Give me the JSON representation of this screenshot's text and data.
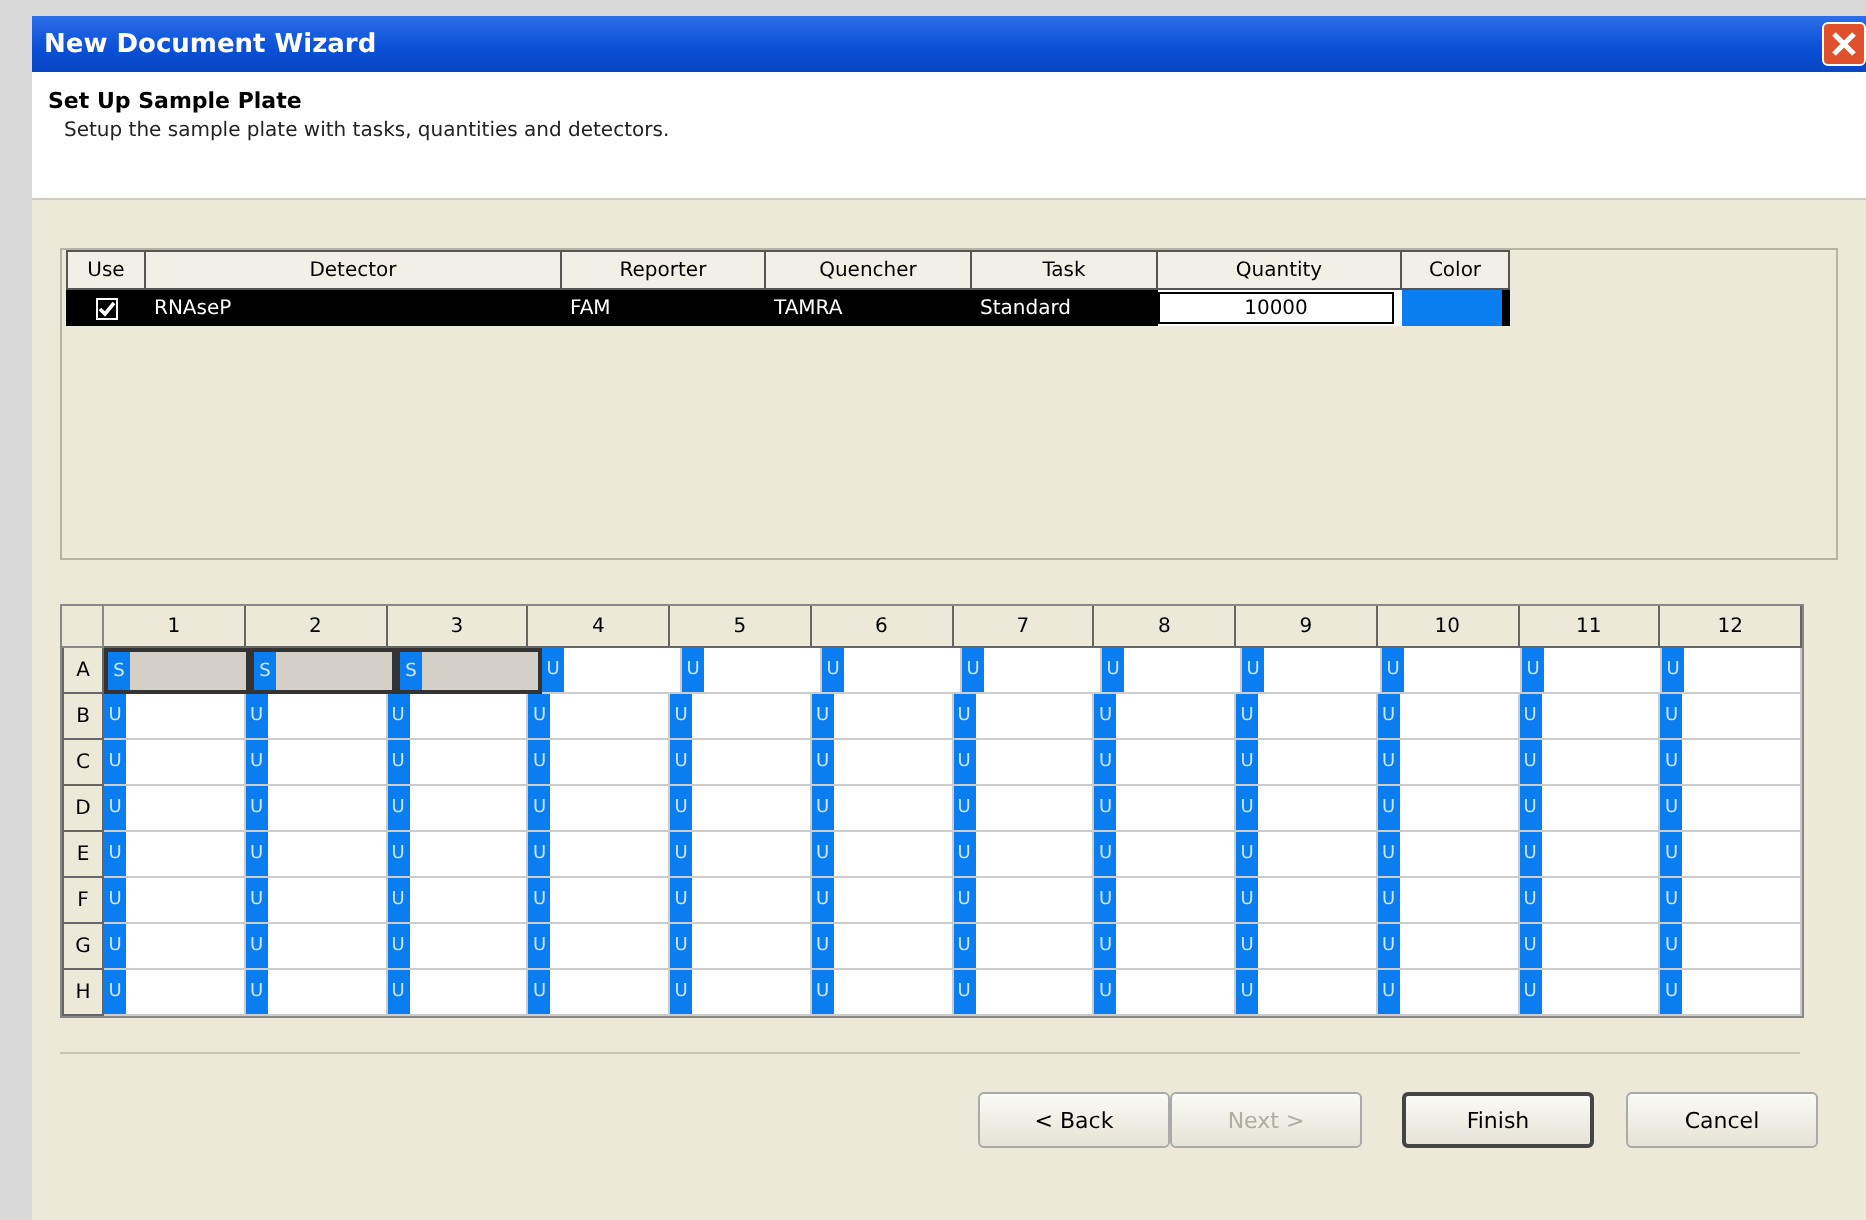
{
  "window": {
    "title": "New Document Wizard"
  },
  "header": {
    "title": "Set Up Sample Plate",
    "description": "Setup the sample plate with tasks, quantities and detectors."
  },
  "detector_table": {
    "columns": [
      "Use",
      "Detector",
      "Reporter",
      "Quencher",
      "Task",
      "Quantity",
      "Color"
    ],
    "rows": [
      {
        "use": true,
        "detector": "RNAseP",
        "reporter": "FAM",
        "quencher": "TAMRA",
        "task": "Standard",
        "quantity": "10000",
        "color": "#0a7ef0",
        "selected": true
      }
    ]
  },
  "plate": {
    "columns": [
      "1",
      "2",
      "3",
      "4",
      "5",
      "6",
      "7",
      "8",
      "9",
      "10",
      "11",
      "12"
    ],
    "rows": [
      {
        "label": "A",
        "wells": [
          {
            "task": "S",
            "selected": true
          },
          {
            "task": "S",
            "selected": true
          },
          {
            "task": "S",
            "selected": true
          },
          {
            "task": "U",
            "selected": false
          },
          {
            "task": "U",
            "selected": false
          },
          {
            "task": "U",
            "selected": false
          },
          {
            "task": "U",
            "selected": false
          },
          {
            "task": "U",
            "selected": false
          },
          {
            "task": "U",
            "selected": false
          },
          {
            "task": "U",
            "selected": false
          },
          {
            "task": "U",
            "selected": false
          },
          {
            "task": "U",
            "selected": false
          }
        ]
      },
      {
        "label": "B",
        "wells": [
          {
            "task": "U",
            "selected": false
          },
          {
            "task": "U",
            "selected": false
          },
          {
            "task": "U",
            "selected": false
          },
          {
            "task": "U",
            "selected": false
          },
          {
            "task": "U",
            "selected": false
          },
          {
            "task": "U",
            "selected": false
          },
          {
            "task": "U",
            "selected": false
          },
          {
            "task": "U",
            "selected": false
          },
          {
            "task": "U",
            "selected": false
          },
          {
            "task": "U",
            "selected": false
          },
          {
            "task": "U",
            "selected": false
          },
          {
            "task": "U",
            "selected": false
          }
        ]
      },
      {
        "label": "C",
        "wells": [
          {
            "task": "U",
            "selected": false
          },
          {
            "task": "U",
            "selected": false
          },
          {
            "task": "U",
            "selected": false
          },
          {
            "task": "U",
            "selected": false
          },
          {
            "task": "U",
            "selected": false
          },
          {
            "task": "U",
            "selected": false
          },
          {
            "task": "U",
            "selected": false
          },
          {
            "task": "U",
            "selected": false
          },
          {
            "task": "U",
            "selected": false
          },
          {
            "task": "U",
            "selected": false
          },
          {
            "task": "U",
            "selected": false
          },
          {
            "task": "U",
            "selected": false
          }
        ]
      },
      {
        "label": "D",
        "wells": [
          {
            "task": "U",
            "selected": false
          },
          {
            "task": "U",
            "selected": false
          },
          {
            "task": "U",
            "selected": false
          },
          {
            "task": "U",
            "selected": false
          },
          {
            "task": "U",
            "selected": false
          },
          {
            "task": "U",
            "selected": false
          },
          {
            "task": "U",
            "selected": false
          },
          {
            "task": "U",
            "selected": false
          },
          {
            "task": "U",
            "selected": false
          },
          {
            "task": "U",
            "selected": false
          },
          {
            "task": "U",
            "selected": false
          },
          {
            "task": "U",
            "selected": false
          }
        ]
      },
      {
        "label": "E",
        "wells": [
          {
            "task": "U",
            "selected": false
          },
          {
            "task": "U",
            "selected": false
          },
          {
            "task": "U",
            "selected": false
          },
          {
            "task": "U",
            "selected": false
          },
          {
            "task": "U",
            "selected": false
          },
          {
            "task": "U",
            "selected": false
          },
          {
            "task": "U",
            "selected": false
          },
          {
            "task": "U",
            "selected": false
          },
          {
            "task": "U",
            "selected": false
          },
          {
            "task": "U",
            "selected": false
          },
          {
            "task": "U",
            "selected": false
          },
          {
            "task": "U",
            "selected": false
          }
        ]
      },
      {
        "label": "F",
        "wells": [
          {
            "task": "U",
            "selected": false
          },
          {
            "task": "U",
            "selected": false
          },
          {
            "task": "U",
            "selected": false
          },
          {
            "task": "U",
            "selected": false
          },
          {
            "task": "U",
            "selected": false
          },
          {
            "task": "U",
            "selected": false
          },
          {
            "task": "U",
            "selected": false
          },
          {
            "task": "U",
            "selected": false
          },
          {
            "task": "U",
            "selected": false
          },
          {
            "task": "U",
            "selected": false
          },
          {
            "task": "U",
            "selected": false
          },
          {
            "task": "U",
            "selected": false
          }
        ]
      },
      {
        "label": "G",
        "wells": [
          {
            "task": "U",
            "selected": false
          },
          {
            "task": "U",
            "selected": false
          },
          {
            "task": "U",
            "selected": false
          },
          {
            "task": "U",
            "selected": false
          },
          {
            "task": "U",
            "selected": false
          },
          {
            "task": "U",
            "selected": false
          },
          {
            "task": "U",
            "selected": false
          },
          {
            "task": "U",
            "selected": false
          },
          {
            "task": "U",
            "selected": false
          },
          {
            "task": "U",
            "selected": false
          },
          {
            "task": "U",
            "selected": false
          },
          {
            "task": "U",
            "selected": false
          }
        ]
      },
      {
        "label": "H",
        "wells": [
          {
            "task": "U",
            "selected": false
          },
          {
            "task": "U",
            "selected": false
          },
          {
            "task": "U",
            "selected": false
          },
          {
            "task": "U",
            "selected": false
          },
          {
            "task": "U",
            "selected": false
          },
          {
            "task": "U",
            "selected": false
          },
          {
            "task": "U",
            "selected": false
          },
          {
            "task": "U",
            "selected": false
          },
          {
            "task": "U",
            "selected": false
          },
          {
            "task": "U",
            "selected": false
          },
          {
            "task": "U",
            "selected": false
          },
          {
            "task": "U",
            "selected": false
          }
        ]
      }
    ]
  },
  "buttons": [
    {
      "label": "< Back",
      "disabled": false,
      "default": false
    },
    {
      "label": "Next >",
      "disabled": true,
      "default": false
    },
    {
      "label": "Finish",
      "disabled": false,
      "default": true
    },
    {
      "label": "Cancel",
      "disabled": false,
      "default": false
    }
  ]
}
